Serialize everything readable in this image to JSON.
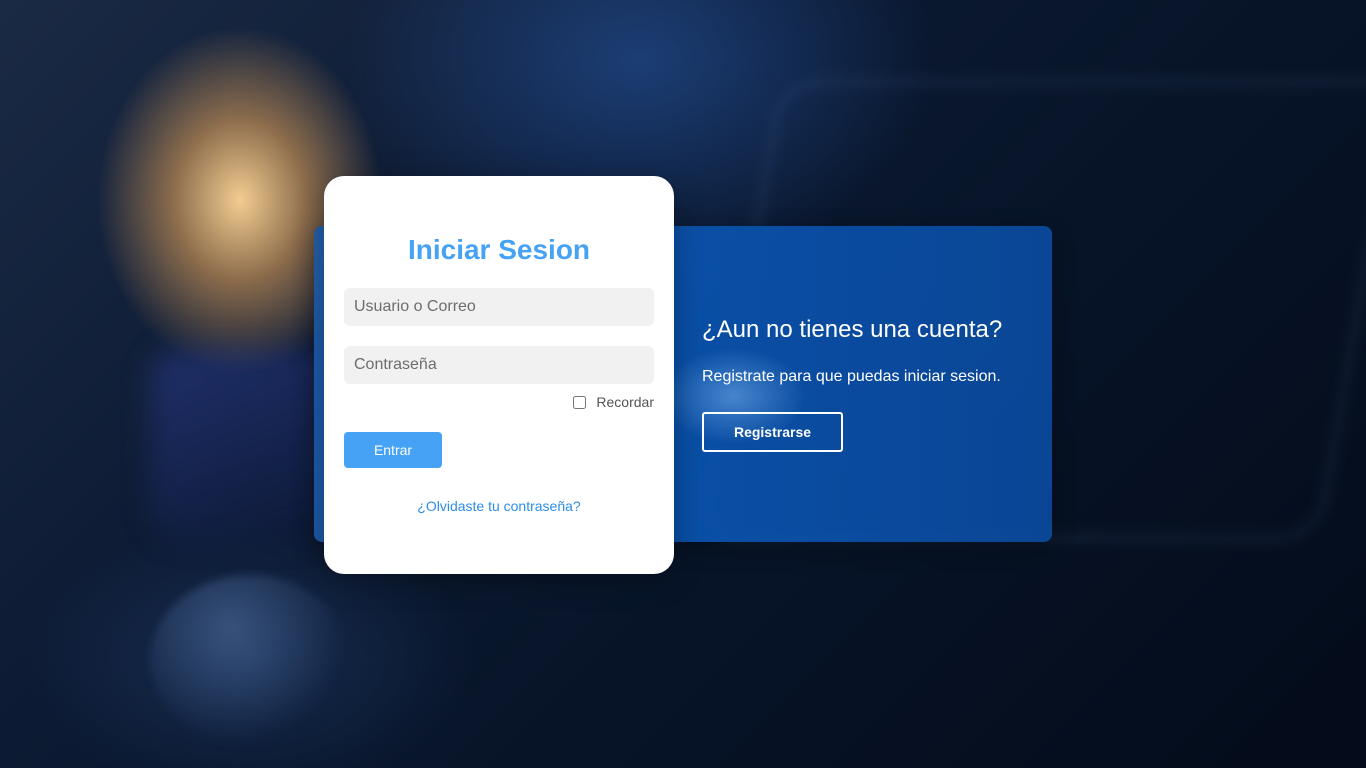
{
  "login": {
    "title": "Iniciar Sesion",
    "username_placeholder": "Usuario o Correo",
    "password_placeholder": "Contraseña",
    "remember_label": "Recordar",
    "remember_checked": false,
    "submit_label": "Entrar",
    "forgot_label": "¿Olvidaste tu contraseña?"
  },
  "register": {
    "title": "¿Aun no tienes una cuenta?",
    "text": "Registrate para que puedas iniciar sesion.",
    "button_label": "Registrarse"
  },
  "colors": {
    "accent": "#46a2f4",
    "panel": "#0a56b3"
  }
}
